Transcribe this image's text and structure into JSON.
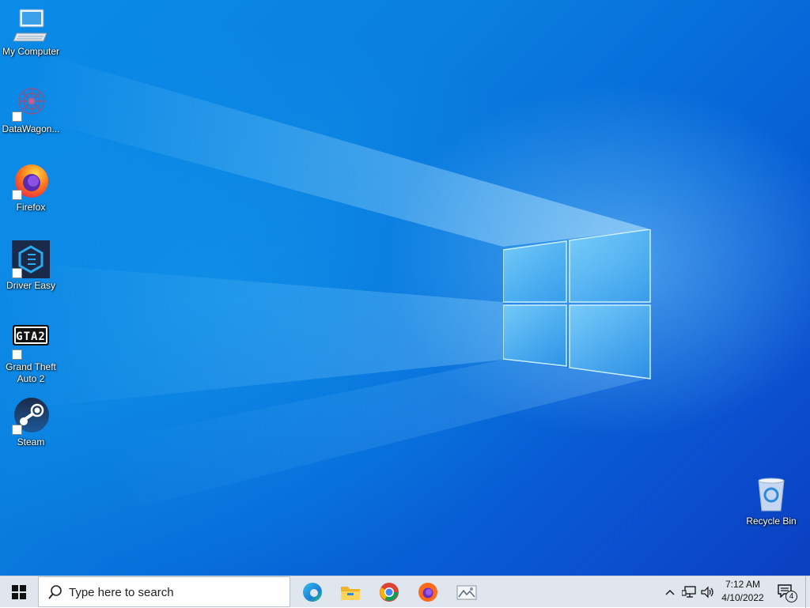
{
  "desktop": {
    "icons": [
      {
        "label": "My Computer",
        "icon": "computer-icon"
      },
      {
        "label": "DataWagon...",
        "icon": "datawagon-icon"
      },
      {
        "label": "Firefox",
        "icon": "firefox-icon"
      },
      {
        "label": "Driver Easy",
        "icon": "driver-easy-icon"
      },
      {
        "label": "Grand Theft Auto 2",
        "icon": "gta2-icon",
        "logo_text": "GTA2"
      },
      {
        "label": "Steam",
        "icon": "steam-icon"
      },
      {
        "label": "Recycle Bin",
        "icon": "recycle-bin-icon"
      }
    ]
  },
  "taskbar": {
    "start_icon": "windows-start-icon",
    "search": {
      "placeholder": "Type here to search",
      "icon": "search-icon"
    },
    "apps": [
      {
        "name": "Microsoft Edge",
        "icon": "edge-icon"
      },
      {
        "name": "File Explorer",
        "icon": "file-explorer-icon"
      },
      {
        "name": "Google Chrome",
        "icon": "chrome-icon"
      },
      {
        "name": "Firefox",
        "icon": "firefox-icon"
      },
      {
        "name": "Image Viewer",
        "icon": "picture-viewer-icon"
      }
    ],
    "tray": {
      "icons": [
        "chevron-up-icon",
        "network-icon",
        "volume-icon"
      ],
      "time": "7:12 AM",
      "date": "4/10/2022",
      "notification_count": "4"
    }
  },
  "colors": {
    "taskbar_bg": "#dfe6ee",
    "desktop_primary": "#0a7fe0",
    "desktop_dark": "#0b3fc0"
  }
}
